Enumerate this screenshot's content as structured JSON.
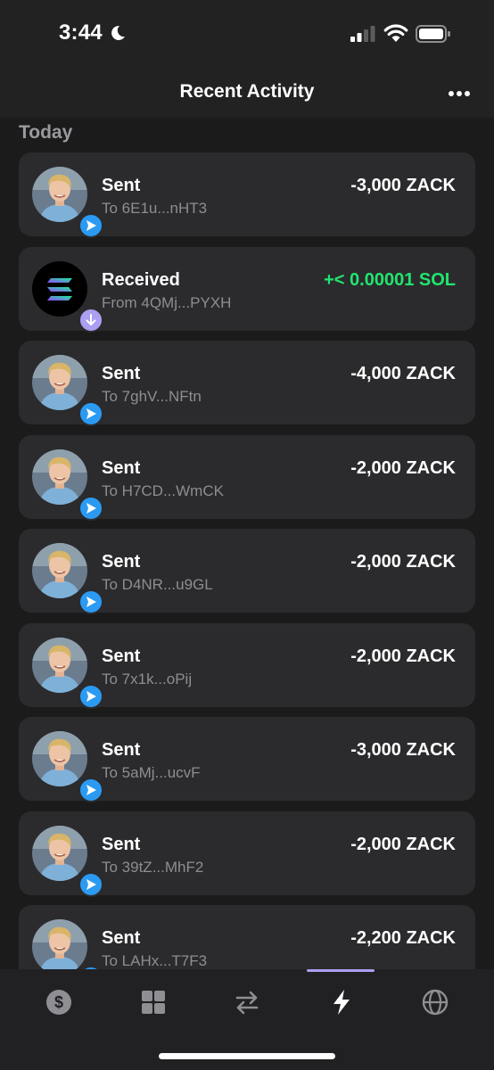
{
  "status_bar": {
    "time": "3:44"
  },
  "header": {
    "title": "Recent Activity"
  },
  "section": {
    "label": "Today"
  },
  "colors": {
    "positive": "#21e56f",
    "accent": "#ab9ff2",
    "sent_badge": "#2b9af3"
  },
  "transactions": [
    {
      "type": "Sent",
      "counterparty": "To 6E1u...nHT3",
      "amount": "-3,000 ZACK"
    },
    {
      "type": "Received",
      "counterparty": "From 4QMj...PYXH",
      "amount": "+< 0.00001 SOL"
    },
    {
      "type": "Sent",
      "counterparty": "To 7ghV...NFtn",
      "amount": "-4,000 ZACK"
    },
    {
      "type": "Sent",
      "counterparty": "To H7CD...WmCK",
      "amount": "-2,000 ZACK"
    },
    {
      "type": "Sent",
      "counterparty": "To D4NR...u9GL",
      "amount": "-2,000 ZACK"
    },
    {
      "type": "Sent",
      "counterparty": "To 7x1k...oPij",
      "amount": "-2,000 ZACK"
    },
    {
      "type": "Sent",
      "counterparty": "To 5aMj...ucvF",
      "amount": "-3,000 ZACK"
    },
    {
      "type": "Sent",
      "counterparty": "To 39tZ...MhF2",
      "amount": "-2,000 ZACK"
    },
    {
      "type": "Sent",
      "counterparty": "To LAHx...T7F3",
      "amount": "-2,200 ZACK"
    }
  ],
  "tabs": [
    {
      "icon": "dollar-icon",
      "active": false
    },
    {
      "icon": "grid-icon",
      "active": false
    },
    {
      "icon": "swap-icon",
      "active": false
    },
    {
      "icon": "lightning-icon",
      "active": true
    },
    {
      "icon": "globe-icon",
      "active": false
    }
  ]
}
